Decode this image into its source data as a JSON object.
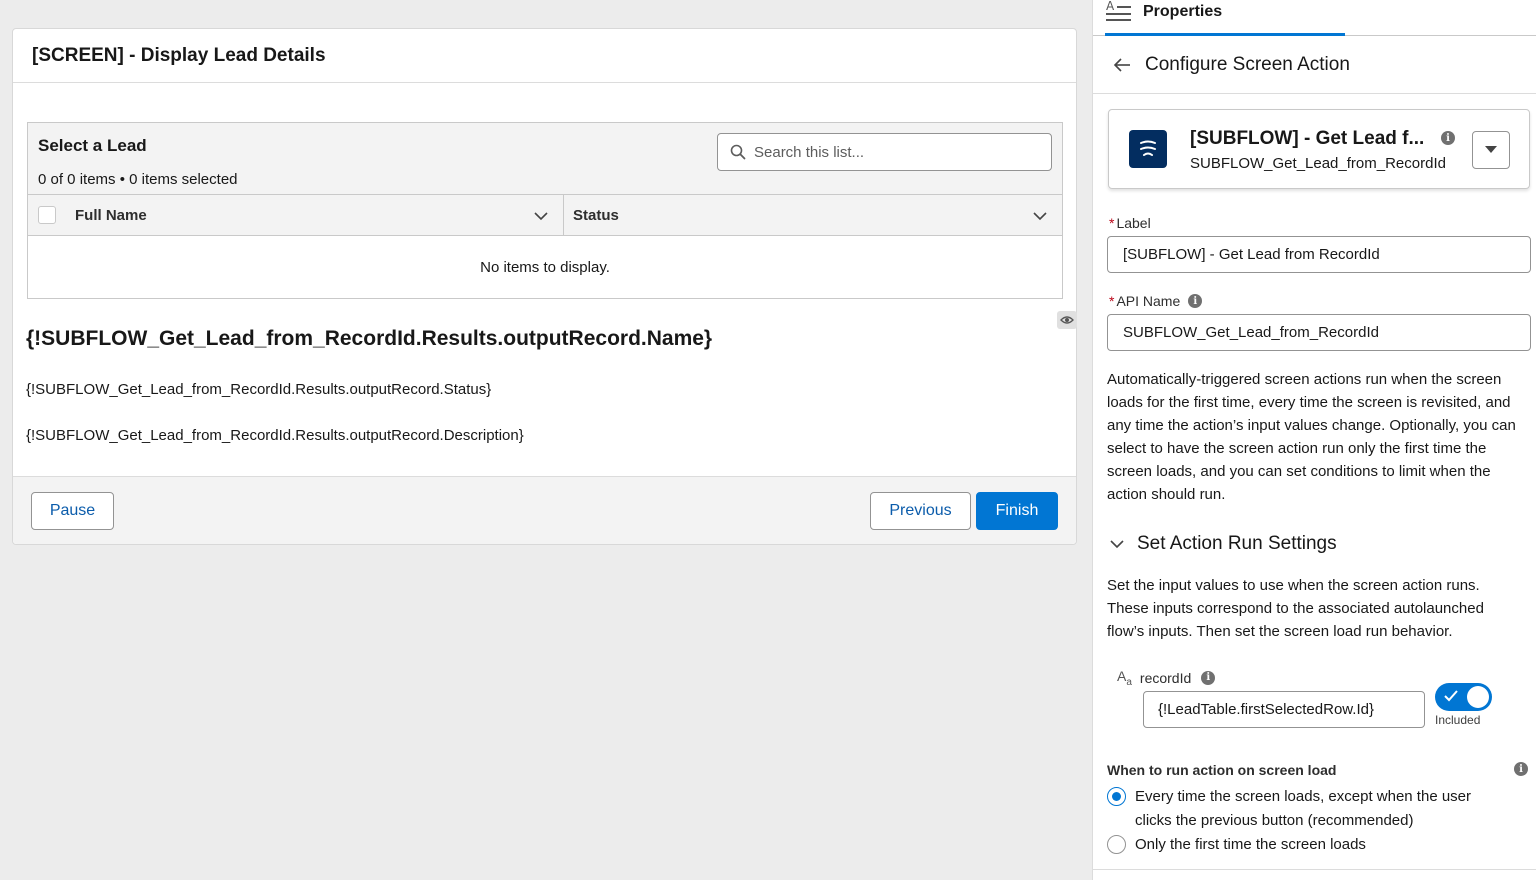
{
  "screen": {
    "title": "[SCREEN] - Display Lead Details",
    "lead_table": {
      "title": "Select a Lead",
      "count_text": "0 of 0 items • 0 items selected",
      "search_placeholder": "Search this list...",
      "columns": [
        "Full Name",
        "Status"
      ],
      "empty_text": "No items to display."
    },
    "merge_name": "{!SUBFLOW_Get_Lead_from_RecordId.Results.outputRecord.Name}",
    "merge_status": "{!SUBFLOW_Get_Lead_from_RecordId.Results.outputRecord.Status}",
    "merge_description": "{!SUBFLOW_Get_Lead_from_RecordId.Results.outputRecord.Description}",
    "footer": {
      "pause_label": "Pause",
      "previous_label": "Previous",
      "finish_label": "Finish"
    }
  },
  "panel": {
    "tab_label": "Properties",
    "subheader_title": "Configure Screen Action",
    "action": {
      "title": "[SUBFLOW] - Get Lead f...",
      "subtitle": "SUBFLOW_Get_Lead_from_RecordId"
    },
    "label_field": {
      "label": "Label",
      "value": "[SUBFLOW] - Get Lead from RecordId"
    },
    "api_name_field": {
      "label": "API Name",
      "value": "SUBFLOW_Get_Lead_from_RecordId"
    },
    "description": "Automatically-triggered screen actions run when the screen loads for the first time, every time the screen is revisited, and any time the action’s input values change. Optionally, you can select to have the screen action run only the first time the screen loads, and you can set conditions to limit when the action should run.",
    "section_title": "Set Action Run Settings",
    "section_description": "Set the input values to use when the screen action runs. These inputs correspond to the associated autolaunched flow’s inputs. Then set the screen load run behavior.",
    "input_var": {
      "name": "recordId",
      "value": "{!LeadTable.firstSelectedRow.Id}",
      "toggle_caption": "Included"
    },
    "when_label": "When to run action on screen load",
    "radio_options": [
      "Every time the screen loads, except when the user clicks the previous button (recommended)",
      "Only the first time the screen loads"
    ]
  },
  "colors": {
    "brand": "#0176d3",
    "flow_icon_bg": "#032d60",
    "required": "#ba0517"
  }
}
